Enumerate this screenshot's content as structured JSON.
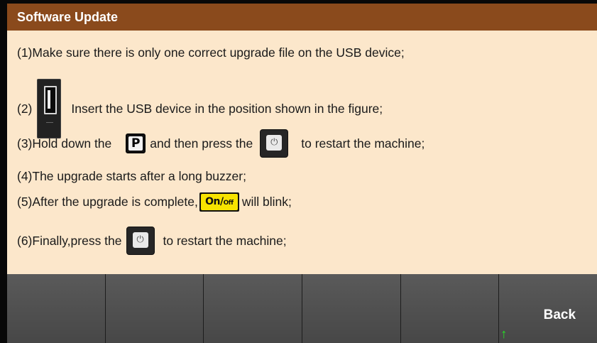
{
  "title": "Software Update",
  "steps": {
    "s1": "(1)Make sure there is only one correct upgrade file on the USB device;",
    "s2_prefix": "(2)",
    "s2_text": "Insert the USB device in the position shown in the figure;",
    "s3_prefix": "(3)Hold down the",
    "s3_mid": "and then press the",
    "s3_suffix": "to restart the machine;",
    "s4": "(4)The upgrade starts after a long buzzer;",
    "s5_prefix": "(5)After the upgrade is complete,",
    "s5_suffix": "will blink;",
    "s6_prefix": "(6)Finally,press the",
    "s6_suffix": "to restart the machine;"
  },
  "keys": {
    "p_label": "P",
    "power_symbol": "⏻",
    "onoff_main": "On/",
    "onoff_small": "Off"
  },
  "softkeys": {
    "back_label": "Back",
    "back_arrow": "↑"
  },
  "colors": {
    "title_bg": "#8a4a1c",
    "content_bg": "#fce7cb",
    "softkey_bg": "#505050",
    "onoff_yellow": "#f7e300",
    "arrow_green": "#22e622"
  },
  "icons": [
    "usb-port-icon",
    "p-key-icon",
    "power-key-icon",
    "onoff-key-icon",
    "return-arrow-icon"
  ]
}
